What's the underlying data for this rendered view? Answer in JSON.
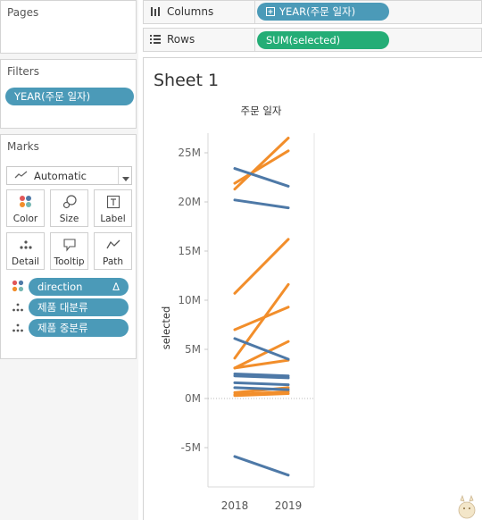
{
  "left": {
    "pages_title": "Pages",
    "filters_title": "Filters",
    "filter_pill": "YEAR(주문 일자)",
    "marks_title": "Marks",
    "mark_type": "Automatic",
    "buttons": {
      "color": "Color",
      "size": "Size",
      "label": "Label",
      "detail": "Detail",
      "tooltip": "Tooltip",
      "path": "Path"
    },
    "mark_pills": [
      {
        "label": "direction",
        "suffix": "Δ"
      },
      {
        "label": "제품 대분류"
      },
      {
        "label": "제품 중분류"
      }
    ]
  },
  "shelves": {
    "columns_label": "Columns",
    "columns_pill": "YEAR(주문 일자)",
    "rows_label": "Rows",
    "rows_pill": "SUM(selected)"
  },
  "sheet": {
    "title": "Sheet 1"
  },
  "colors": {
    "increase": "#f28e2b",
    "decrease": "#4e79a7",
    "blue_pill": "#4b9ab8",
    "green_pill": "#24ad76"
  },
  "chart_data": {
    "type": "line",
    "title": "",
    "header": "주문 일자",
    "xlabel": "",
    "ylabel": "selected",
    "categories": [
      "2018",
      "2019"
    ],
    "yticks": [
      "-5M",
      "0M",
      "5M",
      "10M",
      "15M",
      "20M",
      "25M"
    ],
    "ylim": [
      -9000000,
      27000000
    ],
    "series": [
      {
        "direction": "up",
        "values": [
          21300000,
          26500000
        ]
      },
      {
        "direction": "up",
        "values": [
          21900000,
          25200000
        ]
      },
      {
        "direction": "up",
        "values": [
          10700000,
          16200000
        ]
      },
      {
        "direction": "up",
        "values": [
          4100000,
          11600000
        ]
      },
      {
        "direction": "up",
        "values": [
          7000000,
          9300000
        ]
      },
      {
        "direction": "up",
        "values": [
          3100000,
          5800000
        ]
      },
      {
        "direction": "up",
        "values": [
          3100000,
          3900000
        ]
      },
      {
        "direction": "up",
        "values": [
          600000,
          1100000
        ]
      },
      {
        "direction": "up",
        "values": [
          400000,
          700000
        ]
      },
      {
        "direction": "up",
        "values": [
          300000,
          500000
        ]
      },
      {
        "direction": "down",
        "values": [
          23400000,
          21600000
        ]
      },
      {
        "direction": "down",
        "values": [
          20200000,
          19400000
        ]
      },
      {
        "direction": "down",
        "values": [
          6100000,
          4000000
        ]
      },
      {
        "direction": "down",
        "values": [
          2500000,
          2300000
        ]
      },
      {
        "direction": "down",
        "values": [
          2300000,
          2100000
        ]
      },
      {
        "direction": "down",
        "values": [
          1600000,
          1400000
        ]
      },
      {
        "direction": "down",
        "values": [
          1100000,
          900000
        ]
      },
      {
        "direction": "down",
        "values": [
          -5900000,
          -7800000
        ]
      }
    ]
  }
}
